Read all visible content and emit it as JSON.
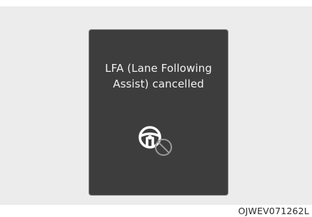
{
  "popup": {
    "line1": "LFA (Lane Following",
    "line2": "Assist) cancelled",
    "icon": "steering-wheel-cancelled-icon"
  },
  "figure_code": "OJWEV071262L",
  "colors": {
    "backdrop": "#ececec",
    "popup_background": "#3d3d3d",
    "popup_text": "#f2f2f2",
    "icon_white": "#ffffff",
    "icon_gray": "#9a9a9a"
  }
}
